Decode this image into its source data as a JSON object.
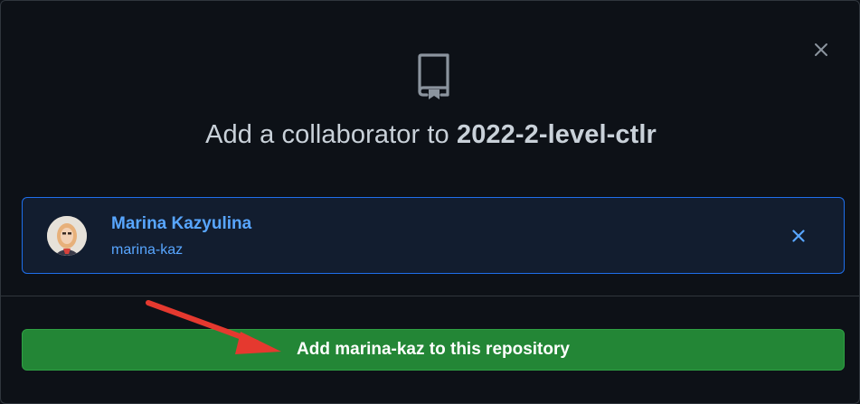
{
  "dialog": {
    "title_prefix": "Add a collaborator to",
    "repo_name": "2022-2-level-ctlr",
    "close_icon": "close-icon",
    "repo_icon": "repo-icon"
  },
  "selected_user": {
    "name": "Marina Kazyulina",
    "login": "marina-kaz",
    "remove_icon": "close-icon"
  },
  "actions": {
    "add_label": "Add marina-kaz to this repository"
  },
  "colors": {
    "background": "#0d1117",
    "accent_blue": "#58a6ff",
    "card_border": "#1f6feb",
    "button_green": "#238636",
    "annotation_arrow": "#e5392f"
  }
}
